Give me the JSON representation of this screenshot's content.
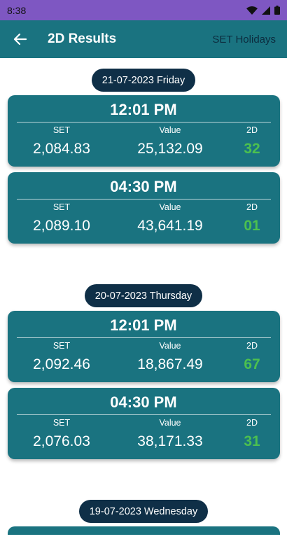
{
  "status": {
    "time": "8:38"
  },
  "appbar": {
    "title": "2D Results",
    "holidays_label": "SET Holidays"
  },
  "labels": {
    "set": "SET",
    "value": "Value",
    "twod": "2D"
  },
  "days": [
    {
      "date": "21-07-2023 Friday",
      "results": [
        {
          "time": "12:01 PM",
          "set": "2,084.83",
          "value": "25,132.09",
          "twod": "32"
        },
        {
          "time": "04:30 PM",
          "set": "2,089.10",
          "value": "43,641.19",
          "twod": "01"
        }
      ]
    },
    {
      "date": "20-07-2023 Thursday",
      "results": [
        {
          "time": "12:01 PM",
          "set": "2,092.46",
          "value": "18,867.49",
          "twod": "67"
        },
        {
          "time": "04:30 PM",
          "set": "2,076.03",
          "value": "38,171.33",
          "twod": "31"
        }
      ]
    },
    {
      "date": "19-07-2023 Wednesday",
      "results": []
    }
  ],
  "colors": {
    "statusbar": "#7e57c2",
    "primary": "#1a7380",
    "pill": "#0f2f47",
    "twod": "#4cc04f"
  }
}
